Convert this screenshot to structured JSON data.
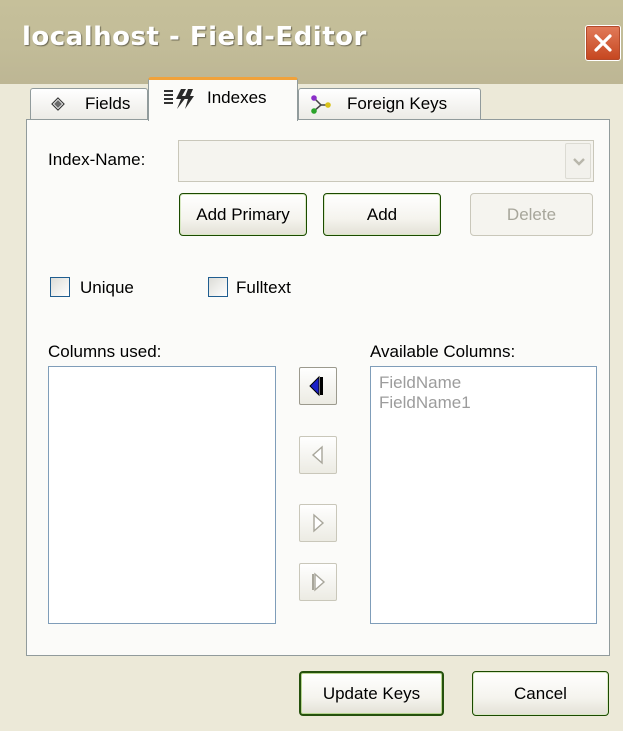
{
  "window": {
    "title": "localhost - Field-Editor"
  },
  "tabs": [
    {
      "label": "Fields",
      "icon": "diamond-icon"
    },
    {
      "label": "Indexes",
      "icon": "index-lightning-icon"
    },
    {
      "label": "Foreign Keys",
      "icon": "foreign-key-icon"
    }
  ],
  "index_name": {
    "label": "Index-Name:",
    "value": ""
  },
  "buttons": {
    "add_primary": "Add Primary",
    "add": "Add",
    "delete": "Delete",
    "update_keys": "Update Keys",
    "cancel": "Cancel"
  },
  "options": {
    "unique": {
      "label": "Unique",
      "checked": false
    },
    "fulltext": {
      "label": "Fulltext",
      "checked": false
    }
  },
  "columns_used": {
    "label": "Columns used:",
    "items": []
  },
  "available_columns": {
    "label": "Available Columns:",
    "items": [
      "FieldName",
      "FieldName1"
    ]
  },
  "colors": {
    "titlebar": "#c2bc98",
    "close_button": "#d3552f",
    "active_tab_accent": "#f1a23a",
    "arrow_active": "#1a20c8"
  }
}
